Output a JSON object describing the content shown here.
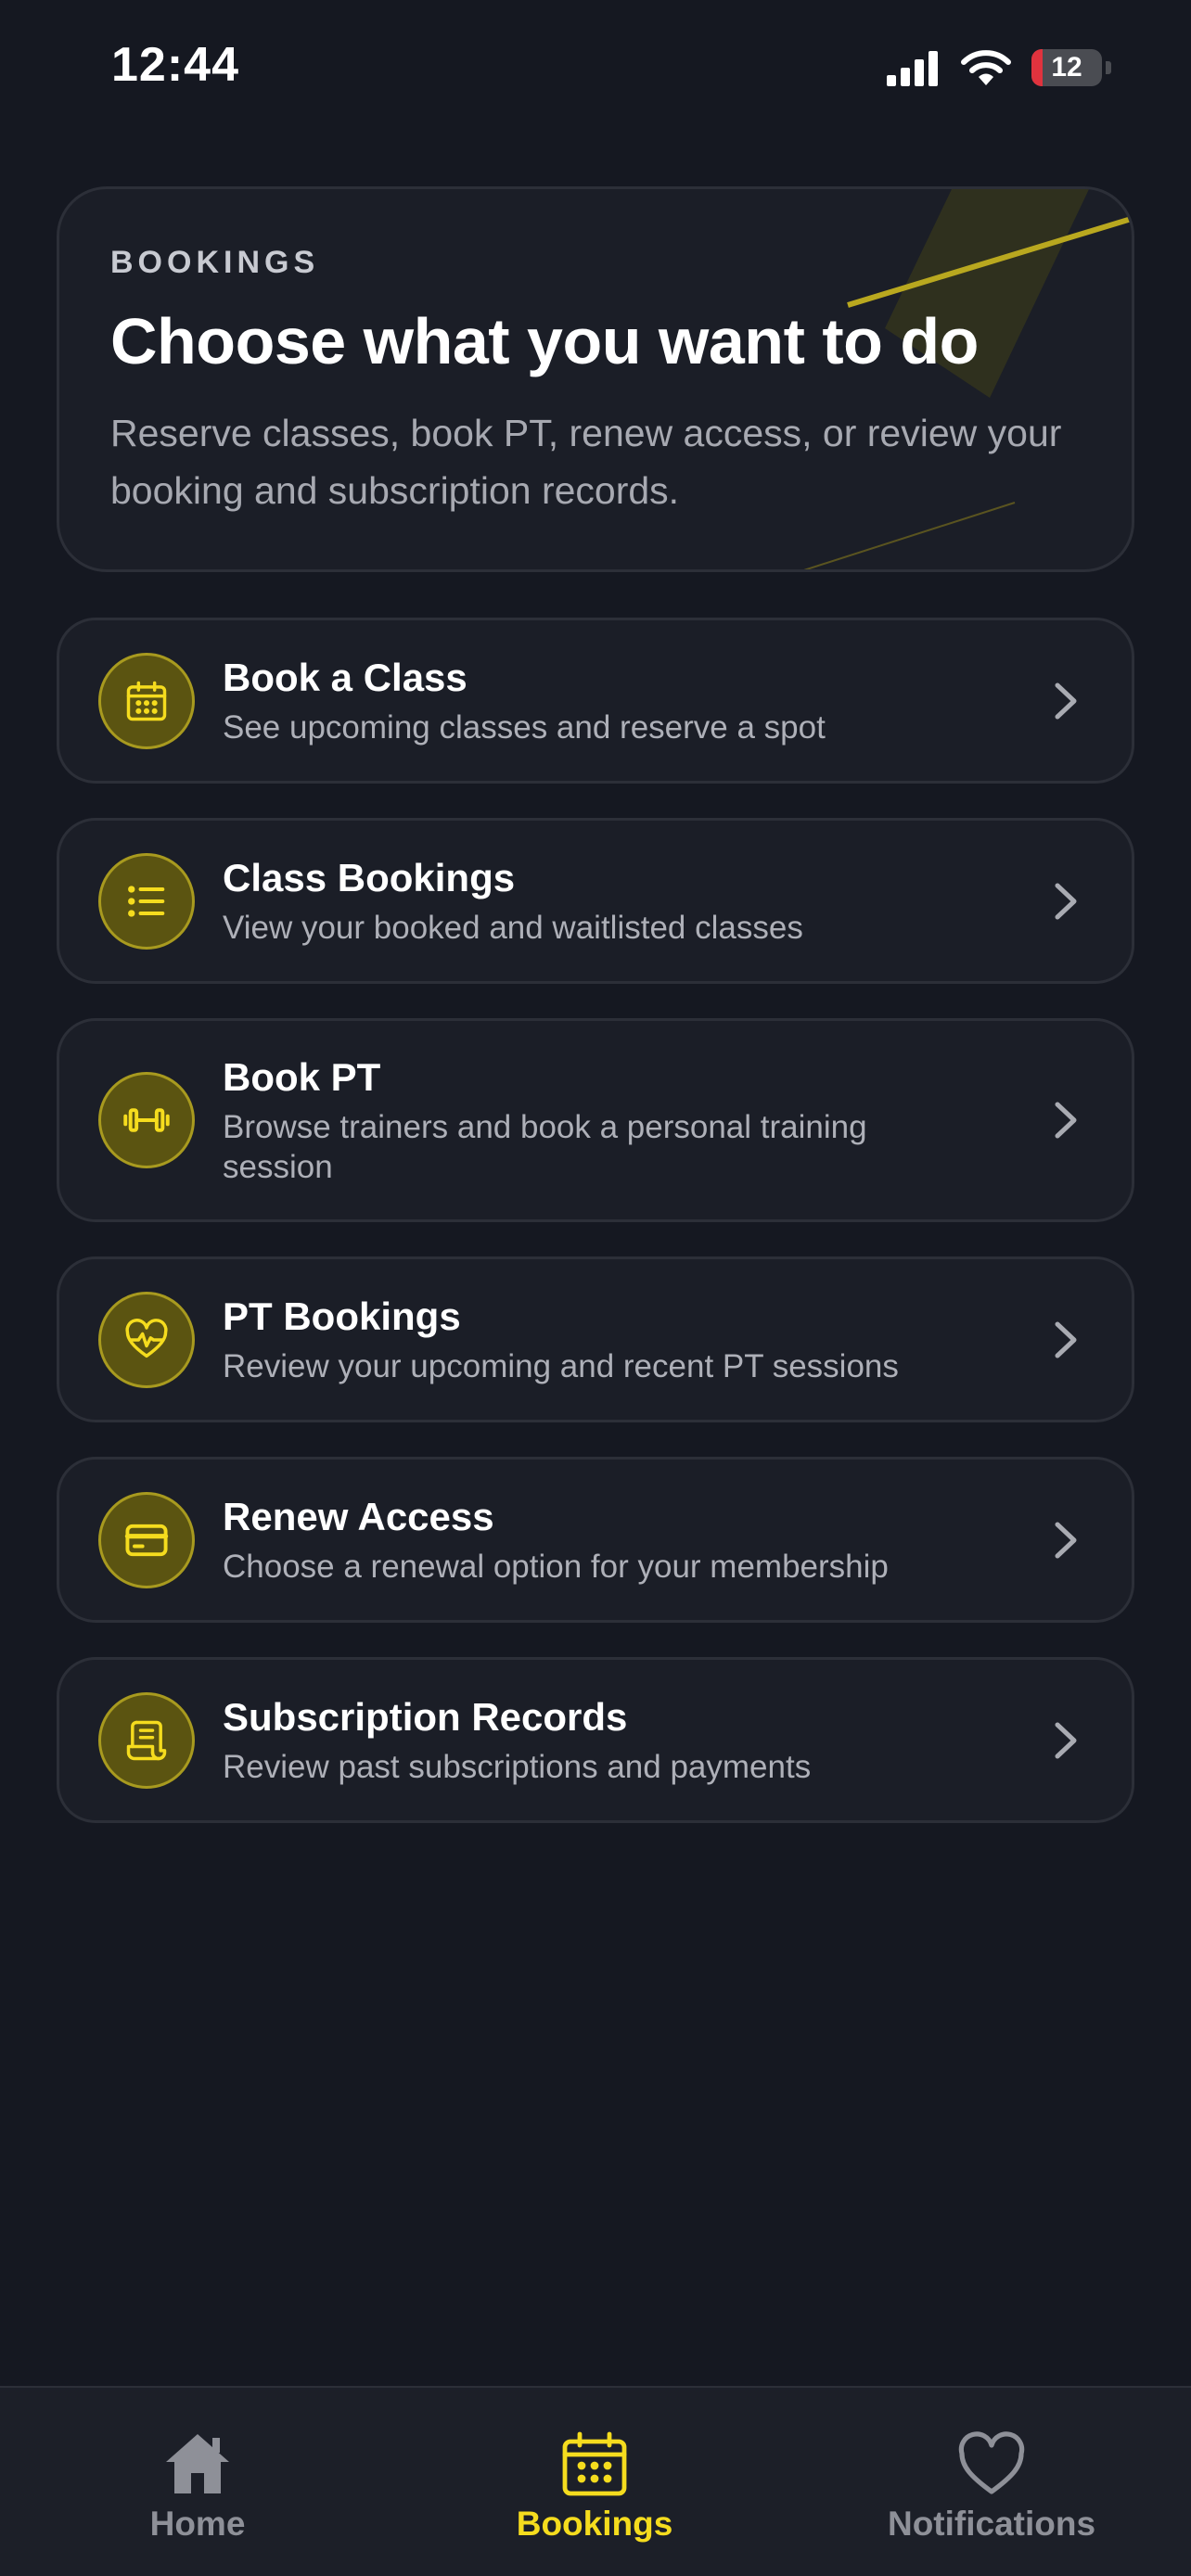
{
  "status_bar": {
    "time": "12:44",
    "battery": "12"
  },
  "header": {
    "eyebrow": "BOOKINGS",
    "title": "Choose what you want to do",
    "subtitle": "Reserve classes, book PT, renew access, or review your booking and subscription records."
  },
  "options": [
    {
      "title": "Book a Class",
      "description": "See upcoming classes and reserve a spot",
      "icon": "calendar-icon"
    },
    {
      "title": "Class Bookings",
      "description": "View your booked and waitlisted classes",
      "icon": "list-icon"
    },
    {
      "title": "Book PT",
      "description": "Browse trainers and book a personal training session",
      "icon": "dumbbell-icon"
    },
    {
      "title": "PT Bookings",
      "description": "Review your upcoming and recent PT sessions",
      "icon": "heart-pulse-icon"
    },
    {
      "title": "Renew Access",
      "description": "Choose a renewal option for your membership",
      "icon": "credit-card-icon"
    },
    {
      "title": "Subscription Records",
      "description": "Review past subscriptions and payments",
      "icon": "receipt-icon"
    }
  ],
  "nav": {
    "home": "Home",
    "bookings": "Bookings",
    "notifications": "Notifications",
    "active": "bookings"
  },
  "colors": {
    "background": "#151821",
    "card": "#1b1e27",
    "accent": "#f5dc1e",
    "accent_dark": "#5b5411",
    "muted": "#8e9098"
  }
}
